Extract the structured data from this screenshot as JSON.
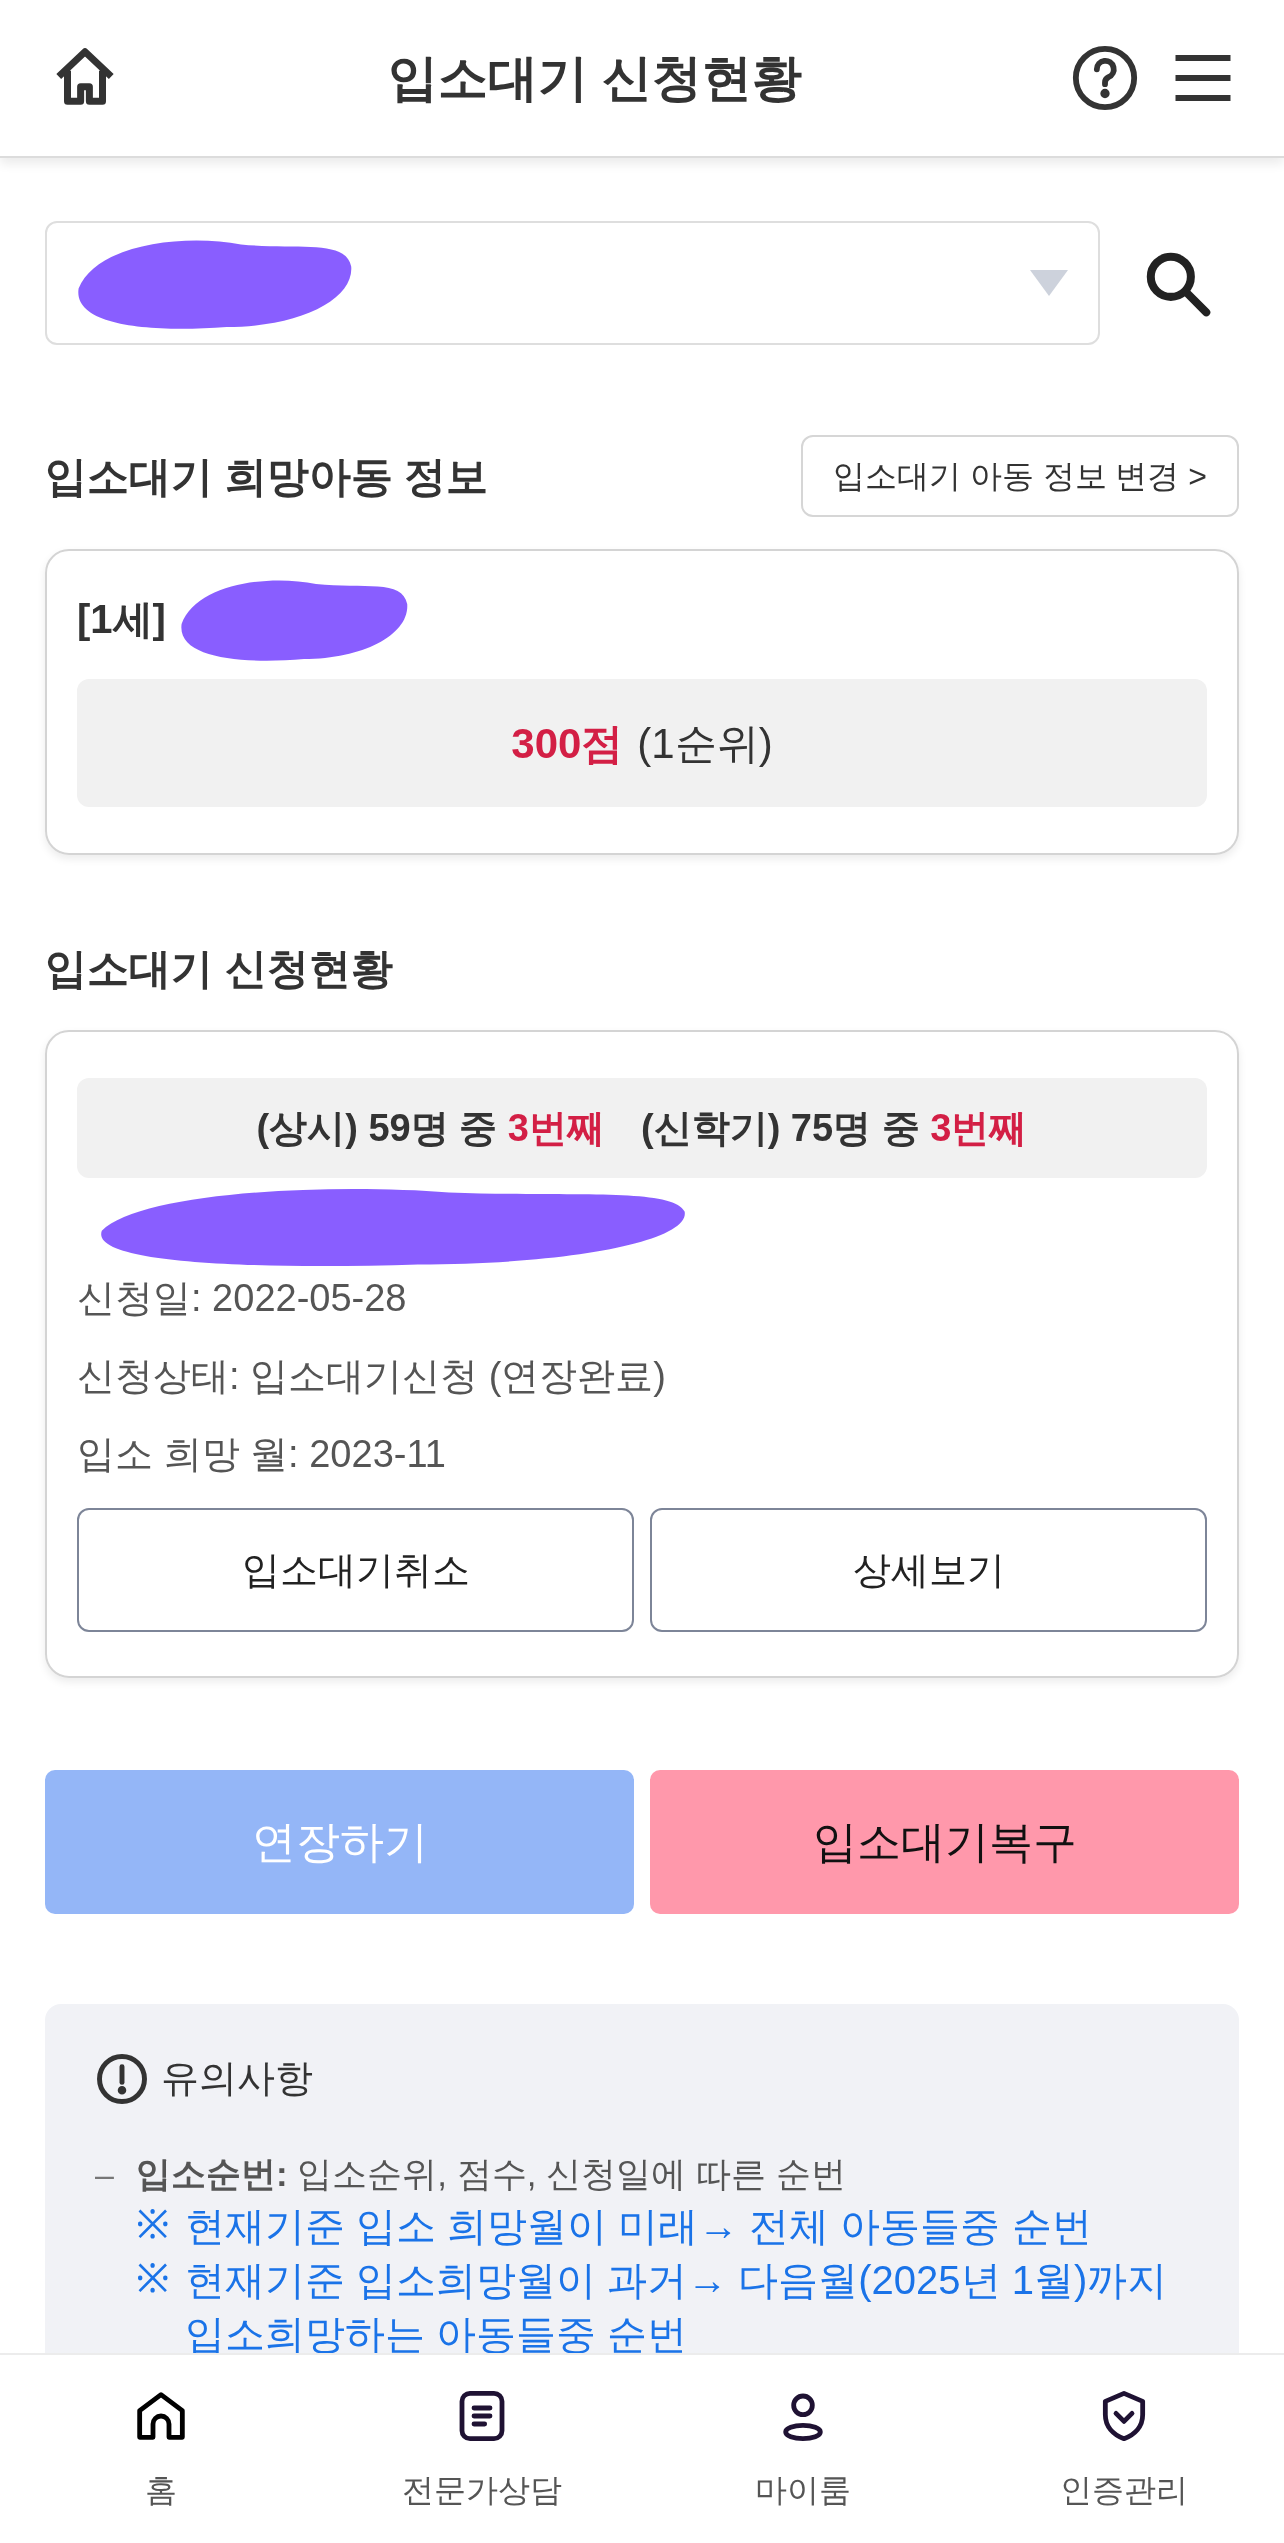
{
  "header": {
    "title": "입소대기 신청현황"
  },
  "child_section": {
    "title": "입소대기 희망아동 정보",
    "edit_button": "입소대기 아동 정보 변경 >",
    "child_label": "[1세]",
    "score": "300점",
    "rank": "(1순위)"
  },
  "status_section": {
    "title": "입소대기 신청현황",
    "queue": [
      {
        "label": "(상시) 59명 중",
        "position": "3번째"
      },
      {
        "label": "(신학기) 75명 중",
        "position": "3번째"
      }
    ],
    "details": [
      "신청일: 2022-05-28",
      "신청상태: 입소대기신청 (연장완료)",
      "입소 희망 월: 2023-11"
    ],
    "buttons": [
      "입소대기취소",
      "상세보기"
    ]
  },
  "actions": [
    {
      "label": "연장하기",
      "kind": "extend",
      "disabled": true
    },
    {
      "label": "입소대기복구",
      "kind": "restore",
      "disabled": false
    }
  ],
  "notice": {
    "title": "유의사항",
    "dash": "–",
    "items": [
      {
        "text": "**입소순번:** 입소순위, 점수, 신청일에 따른 순번",
        "kind": "main"
      },
      {
        "text": "※",
        "kind": "mark"
      },
      {
        "text": "현재기준 입소 희망월이 미래→ 전체 아동들중 순번",
        "kind": "sub"
      },
      {
        "text": "※",
        "kind": "mark"
      },
      {
        "text": "현재기준 입소희망월이 과거→ 다음월(2025년 1월)까지 입소희망하는 아동들중 순번",
        "kind": "sub"
      }
    ]
  },
  "bottom_nav": [
    {
      "label": "홈",
      "kind": "home"
    },
    {
      "label": "전문가상담",
      "kind": "doc"
    },
    {
      "label": "마이룸",
      "kind": "user"
    },
    {
      "label": "인증관리",
      "kind": "shield"
    }
  ]
}
